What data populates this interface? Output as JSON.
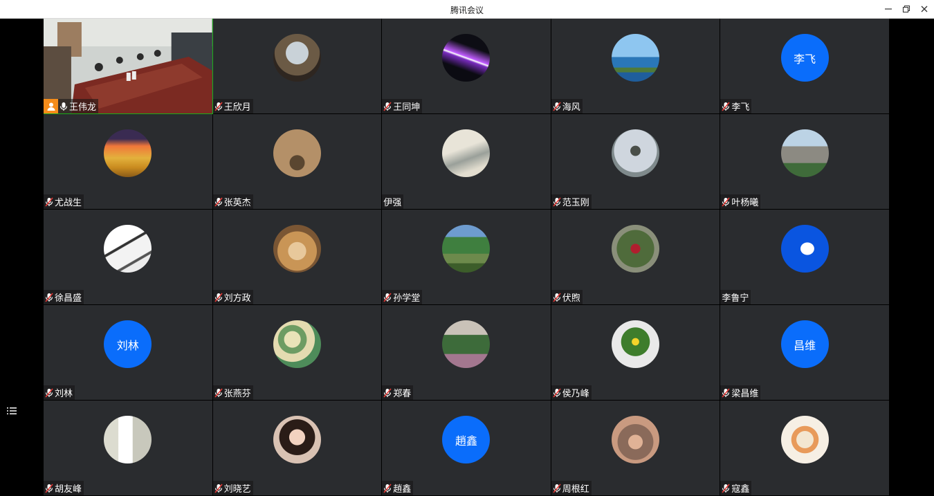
{
  "window": {
    "title": "腾讯会议",
    "minimize_icon": "minimize-icon",
    "restore_icon": "restore-icon",
    "close_icon": "close-icon"
  },
  "sidebar": {
    "list_icon": "participant-list-icon"
  },
  "colors": {
    "text_avatar": "#0a6dfb",
    "tile_bg": "#2a2c2f",
    "active_border": "#1aad19",
    "host_badge": "#f58c1a"
  },
  "participants": [
    {
      "name": "王伟龙",
      "avatar": "video",
      "mic": "on",
      "host": true
    },
    {
      "name": "王欣月",
      "avatar": "photo-window",
      "mic": "muted"
    },
    {
      "name": "王同坤",
      "avatar": "photo-light-streak",
      "mic": "muted"
    },
    {
      "name": "海风",
      "avatar": "photo-sea",
      "mic": "muted"
    },
    {
      "name": "李飞",
      "avatar": "text",
      "avatar_text": "李飞",
      "mic": "muted"
    },
    {
      "name": "尤战生",
      "avatar": "photo-sunset",
      "mic": "muted"
    },
    {
      "name": "张英杰",
      "avatar": "photo-illustration",
      "mic": "muted"
    },
    {
      "name": "伊强",
      "avatar": "photo-ink-painting",
      "mic": "none"
    },
    {
      "name": "范玉刚",
      "avatar": "photo-tree",
      "mic": "muted"
    },
    {
      "name": "叶杨曦",
      "avatar": "photo-building",
      "mic": "muted"
    },
    {
      "name": "徐昌盛",
      "avatar": "photo-architecture",
      "mic": "muted"
    },
    {
      "name": "刘方政",
      "avatar": "photo-hands",
      "mic": "muted"
    },
    {
      "name": "孙学堂",
      "avatar": "photo-garden",
      "mic": "muted"
    },
    {
      "name": "伏煦",
      "avatar": "photo-person-outdoor",
      "mic": "muted"
    },
    {
      "name": "李鲁宁",
      "avatar": "photo-bird",
      "mic": "none"
    },
    {
      "name": "刘林",
      "avatar": "text",
      "avatar_text": "刘林",
      "mic": "muted"
    },
    {
      "name": "张燕芬",
      "avatar": "photo-map",
      "mic": "muted"
    },
    {
      "name": "郑春",
      "avatar": "photo-park",
      "mic": "muted"
    },
    {
      "name": "侯乃峰",
      "avatar": "photo-plant",
      "mic": "muted"
    },
    {
      "name": "梁昌维",
      "avatar": "text",
      "avatar_text": "昌维",
      "mic": "muted"
    },
    {
      "name": "胡友峰",
      "avatar": "photo-calligraphy",
      "mic": "muted"
    },
    {
      "name": "刘晓艺",
      "avatar": "photo-portrait",
      "mic": "muted"
    },
    {
      "name": "趙鑫",
      "avatar": "text",
      "avatar_text": "趙鑫",
      "mic": "muted"
    },
    {
      "name": "周根红",
      "avatar": "photo-child",
      "mic": "muted"
    },
    {
      "name": "寇鑫",
      "avatar": "photo-art",
      "mic": "muted"
    }
  ]
}
